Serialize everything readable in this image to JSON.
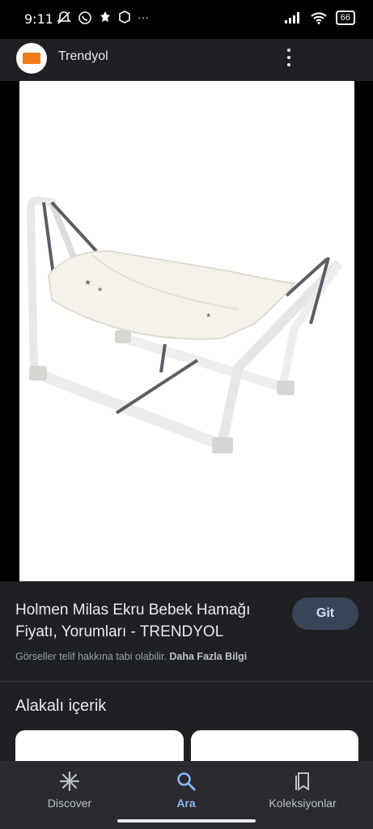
{
  "status_bar": {
    "time": "9:11",
    "battery": "66",
    "left_icons": [
      "muted-notification-icon",
      "whatsapp-icon",
      "notification-icon",
      "box-icon",
      "more-dots-icon"
    ],
    "right_icons": [
      "signal-icon",
      "wifi-icon",
      "battery-icon"
    ]
  },
  "header": {
    "site_name": "Trendyol",
    "logo_icon": "trendyol-logo-icon"
  },
  "result": {
    "title": "Holmen Milas Ekru Bebek Hamağı Fiyatı, Yorumları - TRENDYOL",
    "visit_button": "Git",
    "copyright_text": "Görseller telif hakkına tabi olabilir.",
    "learn_more": "Daha Fazla Bilgi"
  },
  "related": {
    "title": "Alakalı içerik"
  },
  "bottom_nav": {
    "items": [
      {
        "label": "Discover",
        "icon": "asterisk-icon"
      },
      {
        "label": "Ara",
        "icon": "search-icon"
      },
      {
        "label": "Koleksiyonlar",
        "icon": "collections-icon"
      }
    ],
    "active_index": 1
  },
  "colors": {
    "background": "#1f2023",
    "accent": "#8ab4f8",
    "button_bg": "#394457"
  }
}
